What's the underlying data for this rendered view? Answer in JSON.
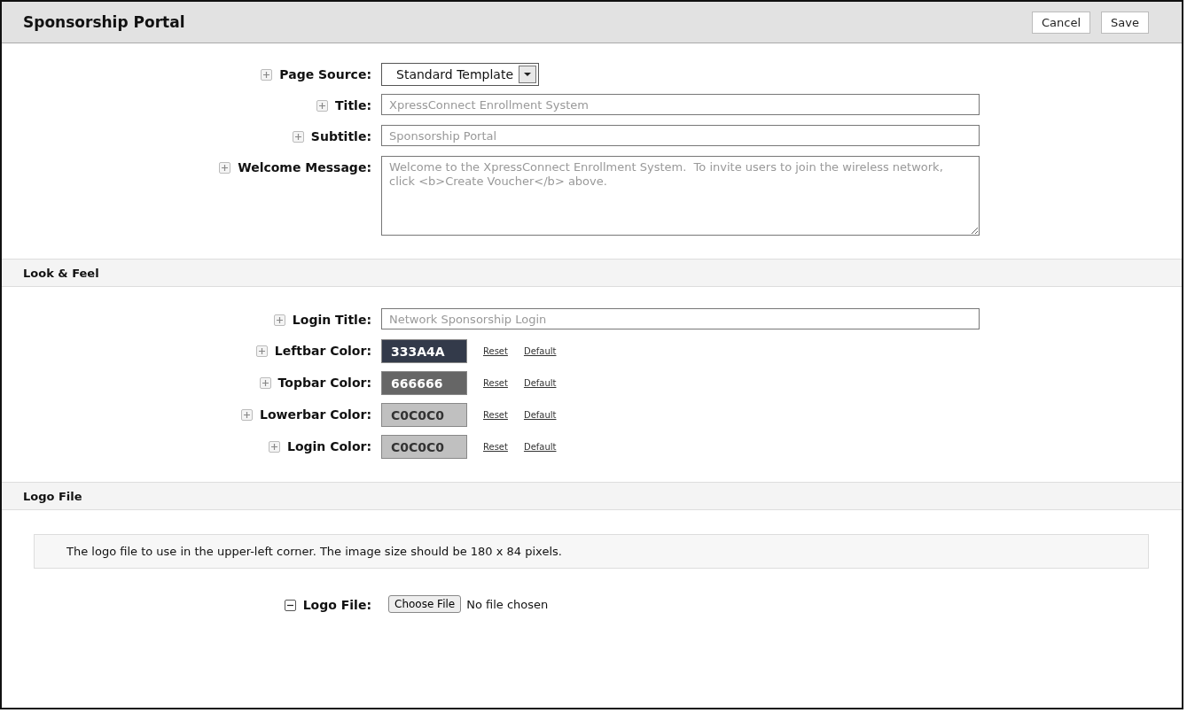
{
  "header": {
    "title": "Sponsorship Portal",
    "buttons": [
      "Cancel",
      "Save"
    ]
  },
  "sections": [
    {
      "fields": [
        {
          "kind": "select",
          "label": "Page Source:",
          "expanded": false,
          "value": "Standard Template"
        },
        {
          "kind": "text",
          "label": "Title:",
          "expanded": false,
          "placeholder": "XpressConnect Enrollment System"
        },
        {
          "kind": "text",
          "label": "Subtitle:",
          "expanded": false,
          "placeholder": "Sponsorship Portal"
        },
        {
          "kind": "textarea",
          "label": "Welcome Message:",
          "expanded": false,
          "placeholder": "Welcome to the XpressConnect Enrollment System.  To invite users to join the wireless network, click <b>Create Voucher</b> above."
        }
      ]
    },
    {
      "heading": "Look & Feel",
      "fields": [
        {
          "kind": "text",
          "label": "Login Title:",
          "expanded": false,
          "placeholder": "Network Sponsorship Login"
        },
        {
          "kind": "color",
          "label": "Leftbar Color:",
          "expanded": false,
          "value": "333A4A",
          "color": "#333a4a",
          "links": [
            "Reset",
            "Default"
          ]
        },
        {
          "kind": "color",
          "label": "Topbar Color:",
          "expanded": false,
          "value": "666666",
          "color": "#666666",
          "links": [
            "Reset",
            "Default"
          ]
        },
        {
          "kind": "color",
          "label": "Lowerbar Color:",
          "expanded": false,
          "value": "C0C0C0",
          "color": "#c0c0c0",
          "links": [
            "Reset",
            "Default"
          ]
        },
        {
          "kind": "color",
          "label": "Login Color:",
          "expanded": false,
          "value": "C0C0C0",
          "color": "#c0c0c0",
          "links": [
            "Reset",
            "Default"
          ]
        }
      ]
    },
    {
      "heading": "Logo File",
      "description": "The logo file to use in the upper-left corner. The image size should be 180 x 84 pixels.",
      "fields": [
        {
          "kind": "file",
          "label": "Logo File:",
          "expanded": true,
          "button": "Choose File",
          "status": "No file chosen"
        }
      ]
    }
  ]
}
